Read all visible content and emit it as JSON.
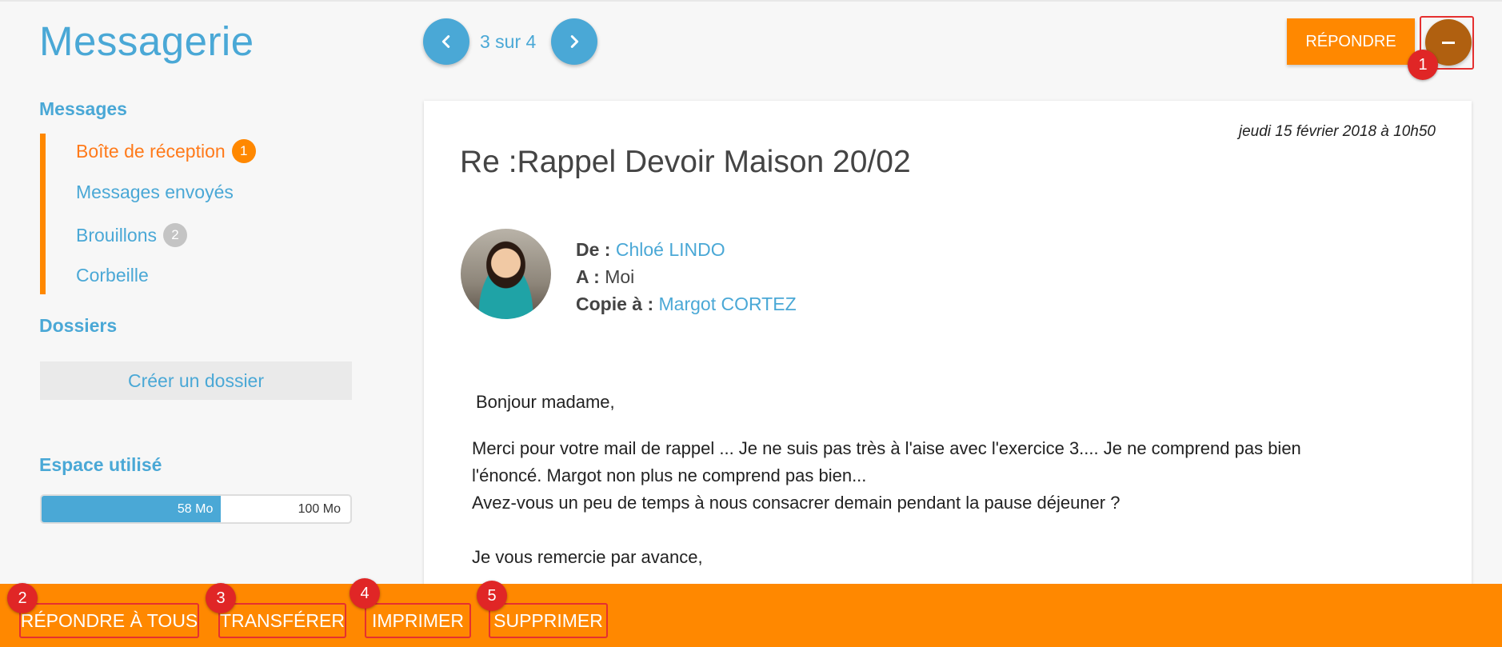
{
  "header": {
    "title": "Messagerie",
    "pagination": "3 sur 4",
    "reply_label": "RÉPONDRE"
  },
  "markers": [
    "1",
    "2",
    "3",
    "4",
    "5"
  ],
  "sidebar": {
    "messages_heading": "Messages",
    "folders": [
      {
        "label": "Boîte de réception",
        "count": "1"
      },
      {
        "label": "Messages envoyés"
      },
      {
        "label": "Brouillons",
        "count": "2"
      },
      {
        "label": "Corbeille"
      }
    ],
    "dossiers_heading": "Dossiers",
    "create_folder_label": "Créer un dossier",
    "storage": {
      "heading": "Espace utilisé",
      "used_label": "58 Mo",
      "total_label": "100 Mo",
      "used_fraction": 0.58
    }
  },
  "message": {
    "date": "jeudi 15 février 2018 à 10h50",
    "subject": "Re :Rappel Devoir Maison 20/02",
    "from_label": "De :",
    "from_name": "Chloé LINDO",
    "to_label": "A :",
    "to_name": "Moi",
    "cc_label": "Copie à :",
    "cc_name": "Margot CORTEZ",
    "body": [
      "Bonjour madame,",
      "Merci pour votre mail de rappel ... Je ne suis pas très à l'aise avec l'exercice 3.... Je ne comprend pas bien",
      "l'énoncé. Margot non plus ne comprend pas bien...",
      "Avez-vous un peu de temps à nous consacrer demain pendant la pause déjeuner ?",
      "Je vous remercie par avance,"
    ]
  },
  "actions": {
    "reply_all": "RÉPONDRE À TOUS",
    "forward": "TRANSFÉRER",
    "print": "IMPRIMER",
    "delete": "SUPPRIMER"
  },
  "colors": {
    "accent_blue": "#4aa8d6",
    "accent_orange": "#ff8800",
    "marker_red": "#e02626"
  }
}
